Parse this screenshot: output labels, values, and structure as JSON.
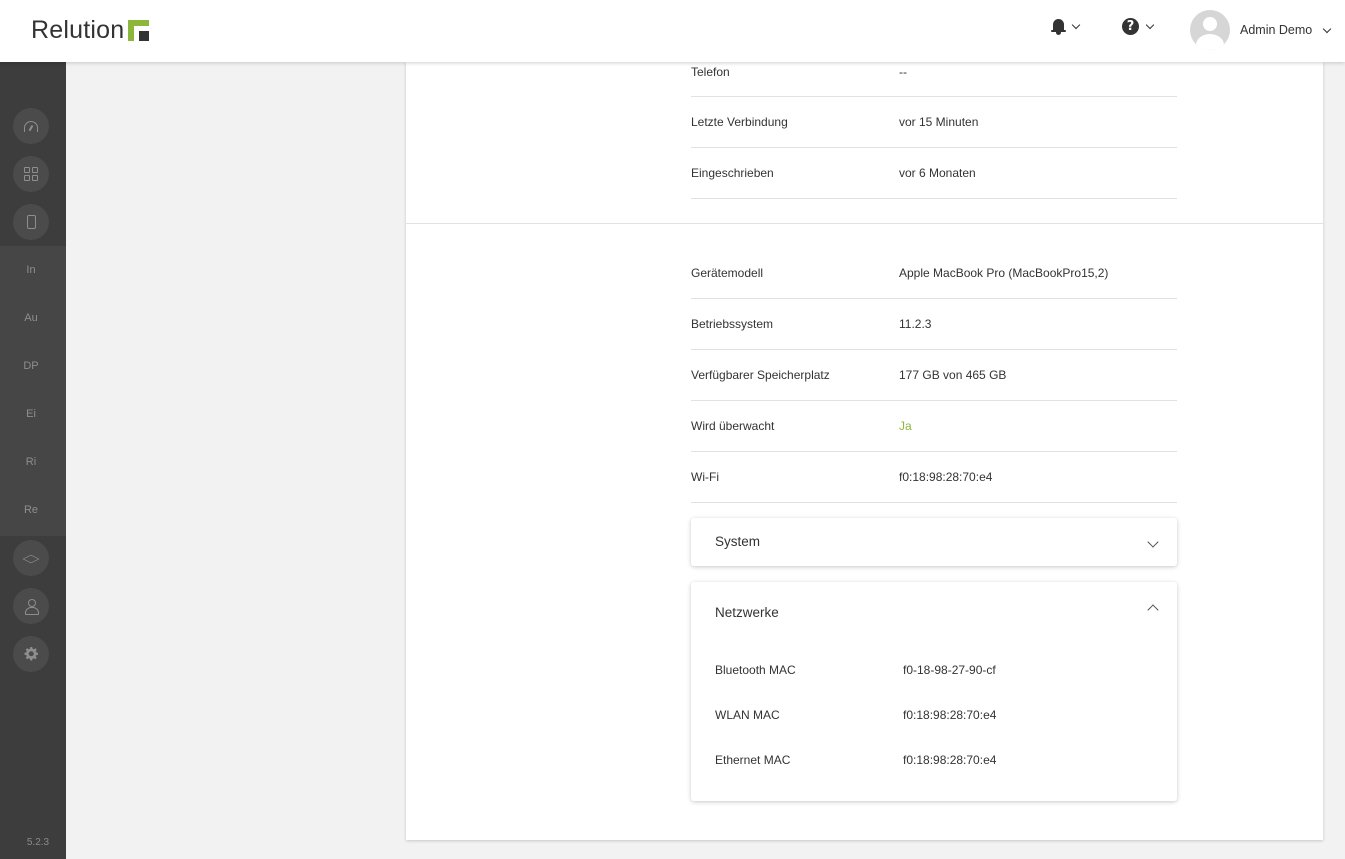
{
  "header": {
    "logo_text": "Relution",
    "user_name": "Admin Demo"
  },
  "sidebar": {
    "items": [
      {
        "icon": "dashboard-gauge-icon"
      },
      {
        "icon": "apps-grid-icon"
      },
      {
        "icon": "device-phone-icon"
      },
      {
        "label": "In"
      },
      {
        "label": "Au"
      },
      {
        "label": "DP"
      },
      {
        "label": "Ei"
      },
      {
        "label": "Ri"
      },
      {
        "label": "Re"
      },
      {
        "icon": "education-cap-icon"
      },
      {
        "icon": "user-icon"
      },
      {
        "icon": "settings-gear-icon"
      }
    ],
    "version": "5.2.3"
  },
  "device_info": {
    "rows_top": [
      {
        "label": "Telefon",
        "value": "--"
      },
      {
        "label": "Letzte Verbindung",
        "value": "vor 15 Minuten"
      },
      {
        "label": "Eingeschrieben",
        "value": "vor 6 Monaten"
      }
    ],
    "rows_hw": [
      {
        "label": "Gerätemodell",
        "value": "Apple MacBook Pro (MacBookPro15,2)"
      },
      {
        "label": "Betriebssystem",
        "value": "11.2.3"
      },
      {
        "label": "Verfügbarer Speicherplatz",
        "value": "177 GB von 465 GB"
      },
      {
        "label": "Wird überwacht",
        "value": "Ja"
      },
      {
        "label": "Wi-Fi",
        "value": "f0:18:98:28:70:e4"
      }
    ]
  },
  "panels": {
    "system": {
      "title": "System",
      "expanded": false
    },
    "networks": {
      "title": "Netzwerke",
      "expanded": true,
      "rows": [
        {
          "label": "Bluetooth MAC",
          "value": "f0-18-98-27-90-cf"
        },
        {
          "label": "WLAN MAC",
          "value": "f0:18:98:28:70:e4"
        },
        {
          "label": "Ethernet MAC",
          "value": "f0:18:98:28:70:e4"
        }
      ]
    }
  },
  "colors": {
    "accent": "#8cb63c",
    "sidebar_bg": "#3d3d3d",
    "text": "#333333"
  }
}
